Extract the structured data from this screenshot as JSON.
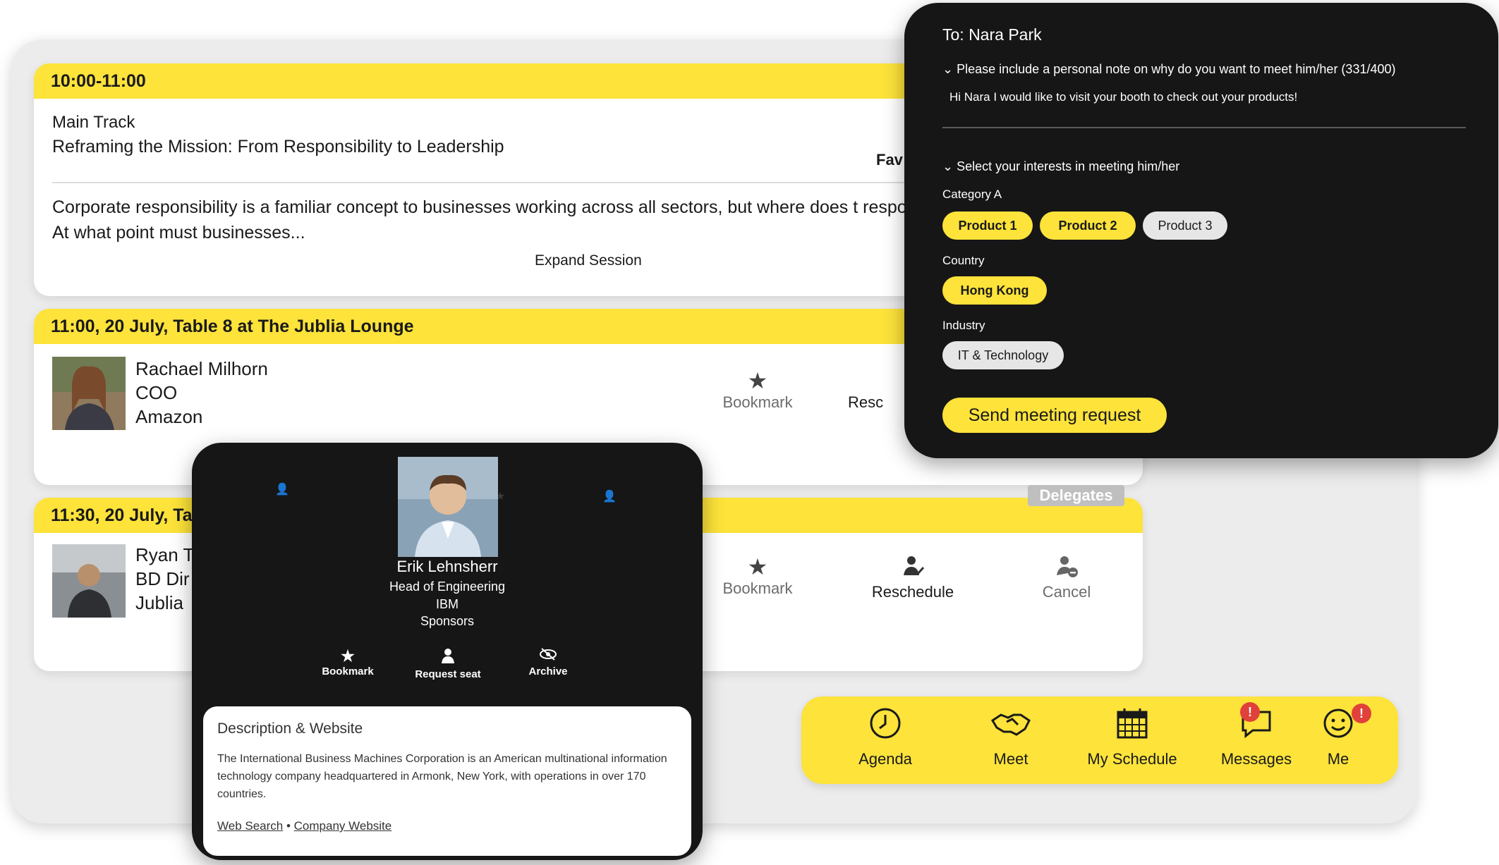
{
  "sessions": {
    "s1": {
      "time": "10:00-11:00",
      "track": "Main Track",
      "title": "Reframing the Mission: From Responsibility to Leadership",
      "fav": "Fav",
      "description": "Corporate responsibility is a familiar concept to businesses working across all sectors, but where does t responsibility and leadership? At what point must businesses...",
      "expand": "Expand Session"
    },
    "s2": {
      "header": "11:00, 20 July, Table 8 at The Jublia Lounge",
      "name": "Rachael Milhorn",
      "role": "COO",
      "company": "Amazon",
      "bookmark": "Bookmark",
      "reschedule": "Resc"
    },
    "s3": {
      "header": "11:30, 20 July, Ta",
      "name": "Ryan T",
      "role": "BD Dir",
      "company": "Jublia",
      "bookmark": "Bookmark",
      "reschedule": "Reschedule",
      "cancel": "Cancel",
      "tag": "Delegates"
    }
  },
  "profile": {
    "name": "Erik Lehnsherr",
    "title": "Head of Engineering",
    "company": "IBM",
    "category": "Sponsors",
    "actions": {
      "bookmark": "Bookmark",
      "request": "Request seat",
      "archive": "Archive"
    },
    "desc_title": "Description & Website",
    "desc_text": "The International Business Machines Corporation is an American multinational information technology company headquartered in Armonk, New York, with operations in over 170 countries.",
    "link_search": "Web Search",
    "link_sep": "•",
    "link_site": "Company Website"
  },
  "meeting": {
    "to": "To: Nara Park",
    "note_label": "Please include a personal note on why do you want to meet him/her (331/400)",
    "note_text": "Hi Nara I would like to visit your booth to check out your products!",
    "select_label": "Select your interests in meeting him/her",
    "category_a": "Category A",
    "products": [
      "Product 1",
      "Product 2",
      "Product 3"
    ],
    "country_label": "Country",
    "country": "Hong Kong",
    "industry_label": "Industry",
    "industry": "IT & Technology",
    "send": "Send meeting request"
  },
  "nav": {
    "items": [
      "Agenda",
      "Meet",
      "My Schedule",
      "Messages",
      "Me"
    ],
    "badge": "!"
  },
  "colors": {
    "accent": "#fde33a",
    "dark": "#161616",
    "badge": "#e0413a"
  }
}
